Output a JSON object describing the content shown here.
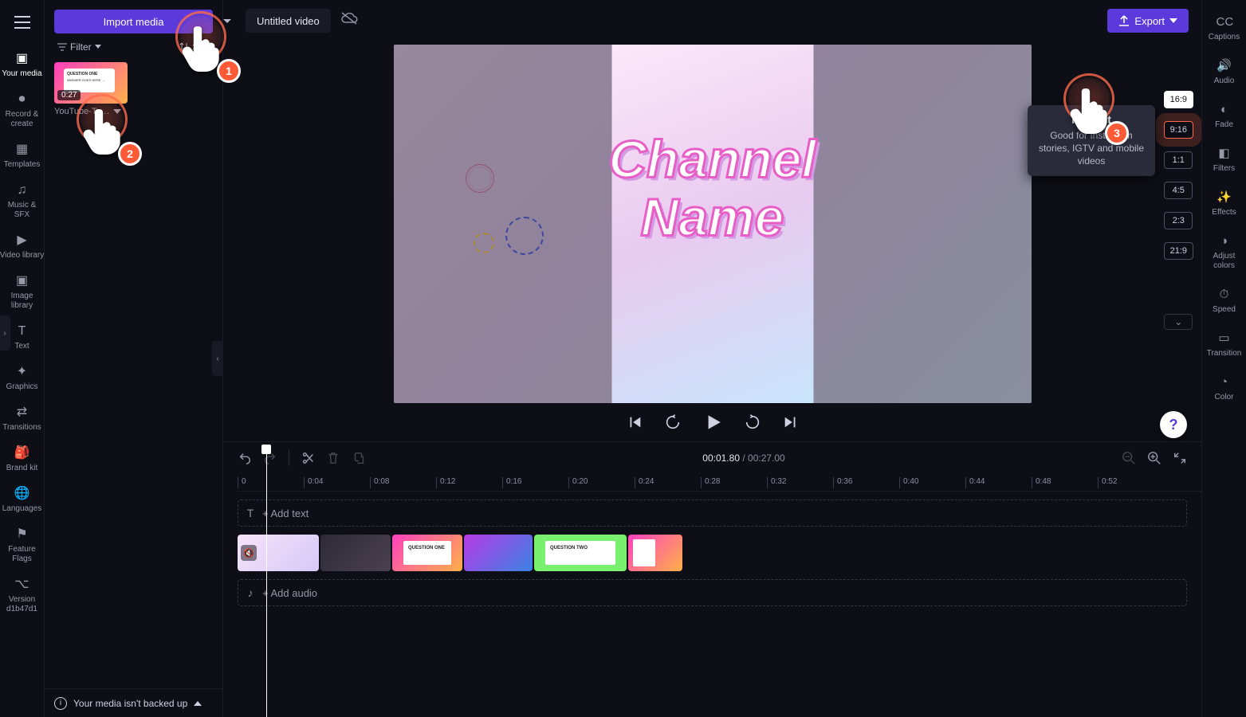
{
  "topbar": {
    "import_label": "Import media",
    "project_title": "Untitled video",
    "export_label": "Export"
  },
  "leftnav": {
    "items": [
      {
        "label": "Your media",
        "icon": "media-icon",
        "active": true
      },
      {
        "label": "Record & create",
        "icon": "record-icon"
      },
      {
        "label": "Templates",
        "icon": "templates-icon"
      },
      {
        "label": "Music & SFX",
        "icon": "music-icon"
      },
      {
        "label": "Video library",
        "icon": "video-lib-icon"
      },
      {
        "label": "Image library",
        "icon": "image-lib-icon"
      },
      {
        "label": "Text",
        "icon": "text-icon"
      },
      {
        "label": "Graphics",
        "icon": "graphics-icon"
      },
      {
        "label": "Transitions",
        "icon": "transitions-icon"
      },
      {
        "label": "Brand kit",
        "icon": "brandkit-icon"
      },
      {
        "label": "Languages",
        "icon": "languages-icon"
      },
      {
        "label": "Feature Flags",
        "icon": "featureflags-icon"
      },
      {
        "label": "Version d1b47d1",
        "icon": "version-icon"
      }
    ]
  },
  "media_panel": {
    "filter_label": "Filter",
    "sort_label": "Sort",
    "thumb": {
      "duration": "0:27",
      "title": "YouTube-Te…",
      "card_title": "QUESTION ONE",
      "card_sub": "ANSWER GOES HERE →"
    },
    "backup_msg": "Your media isn't backed up"
  },
  "preview": {
    "text_line1": "Channel",
    "text_line2": "Name"
  },
  "aspect_tooltip": {
    "title": "Portrait",
    "desc": "Good for Instagram stories, IGTV and mobile videos"
  },
  "aspect_ratios": [
    "16:9",
    "9:16",
    "1:1",
    "4:5",
    "2:3",
    "21:9"
  ],
  "aspect_selected": "16:9",
  "aspect_highlight": "9:16",
  "rightnav": {
    "items": [
      {
        "label": "Captions",
        "icon": "captions-icon"
      },
      {
        "label": "Audio",
        "icon": "audio-icon"
      },
      {
        "label": "Fade",
        "icon": "fade-icon"
      },
      {
        "label": "Filters",
        "icon": "filters-icon"
      },
      {
        "label": "Effects",
        "icon": "effects-icon"
      },
      {
        "label": "Adjust colors",
        "icon": "adjust-icon"
      },
      {
        "label": "Speed",
        "icon": "speed-icon"
      },
      {
        "label": "Transition",
        "icon": "transition-icon"
      },
      {
        "label": "Color",
        "icon": "color-icon"
      }
    ]
  },
  "timeline": {
    "current": "00:01.80",
    "duration": "00:27.00",
    "ruler": [
      "0",
      "0:04",
      "0:08",
      "0:12",
      "0:16",
      "0:20",
      "0:24",
      "0:28",
      "0:32",
      "0:36",
      "0:40",
      "0:44",
      "0:48",
      "0:52"
    ],
    "ruler_spacing_px": 83,
    "text_track_placeholder": "+ Add text",
    "audio_track_placeholder": "+ Add audio",
    "clip_cards": {
      "c2": "QUESTION ONE",
      "c4": "QUESTION TWO"
    }
  },
  "annotations": {
    "a": "1",
    "b": "2",
    "c": "3"
  }
}
